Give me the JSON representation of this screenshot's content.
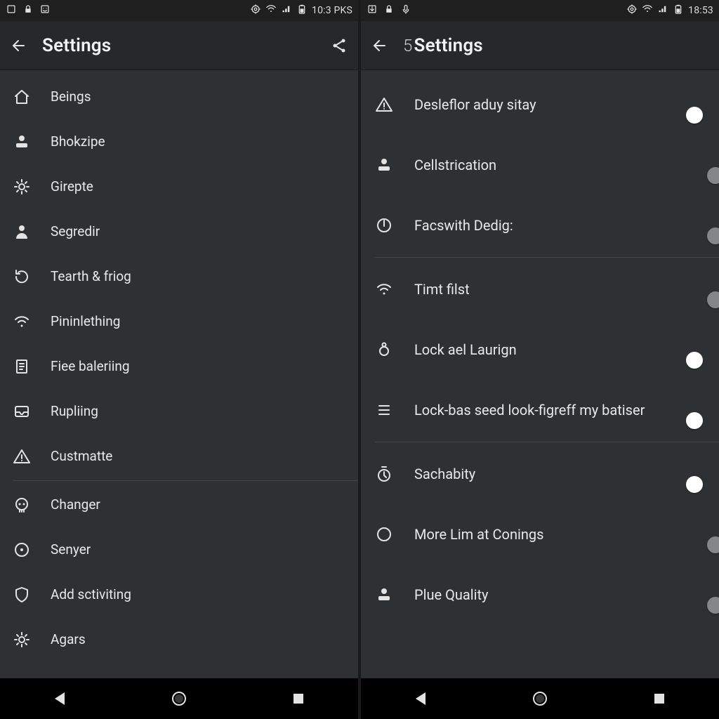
{
  "left": {
    "status": {
      "time": "10:3 PKS"
    },
    "header": {
      "title": "Settings"
    },
    "items": [
      {
        "icon": "home",
        "label": "Beings"
      },
      {
        "icon": "person-card",
        "label": "Bhokzipe"
      },
      {
        "icon": "gear",
        "label": "Girepte"
      },
      {
        "icon": "person",
        "label": "Segredir"
      },
      {
        "icon": "refresh",
        "label": "Tearth & friog"
      },
      {
        "icon": "wifi",
        "label": "Pininlething"
      },
      {
        "icon": "document",
        "label": "Fiee baleriing"
      },
      {
        "icon": "inbox",
        "label": "Rupliing"
      },
      {
        "icon": "warning",
        "label": "Custmatte"
      },
      {
        "icon": "skull",
        "label": "Changer",
        "sep_before": true
      },
      {
        "icon": "target",
        "label": "Senyer"
      },
      {
        "icon": "shield",
        "label": "Add sctiviting"
      },
      {
        "icon": "gear",
        "label": "Agars"
      }
    ]
  },
  "right": {
    "status": {
      "time": "18:53"
    },
    "header": {
      "prefix": "5",
      "title": "Settings"
    },
    "items": [
      {
        "icon": "warning",
        "label": "Desleflor aduy sitay",
        "toggle": true
      },
      {
        "icon": "person-card",
        "label": "Cellstrication",
        "toggle": false
      },
      {
        "icon": "power",
        "label": "Facswith Dedig:",
        "toggle": false,
        "sep_after": true
      },
      {
        "icon": "wifi",
        "label": "Timt filst",
        "toggle": false
      },
      {
        "icon": "ring",
        "label": "Lock ael Laurign",
        "toggle": true
      },
      {
        "icon": "list",
        "label": "Lock-bas seed look-figreff my batiser",
        "toggle": true,
        "sep_after": true
      },
      {
        "icon": "timer",
        "label": "Sachabity",
        "toggle": true
      },
      {
        "icon": "circle",
        "label": "More Lim at Conings",
        "toggle": false
      },
      {
        "icon": "person-card",
        "label": "Plue Quality",
        "toggle": false
      }
    ]
  }
}
